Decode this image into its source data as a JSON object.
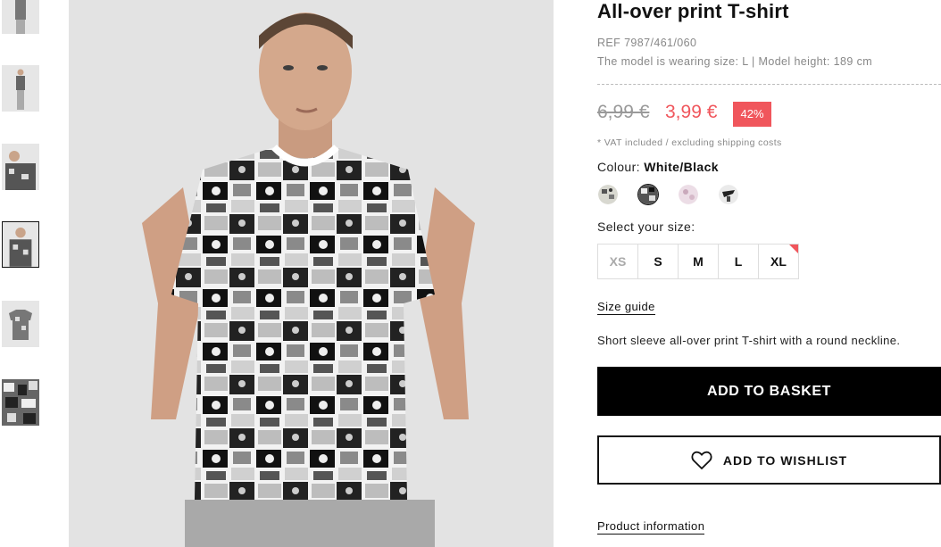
{
  "product": {
    "title": "All-over print T-shirt",
    "ref": "REF 7987/461/060",
    "model_info": "The model is wearing size: L | Model height: 189 cm",
    "price_old": "6,99 €",
    "price_new": "3,99 €",
    "discount": "42%",
    "vat_note": "* VAT included / excluding shipping costs",
    "colour_label": "Colour:",
    "colour_value": "White/Black",
    "size_label": "Select your size:",
    "sizes": [
      "XS",
      "S",
      "M",
      "L",
      "XL"
    ],
    "size_guide": "Size guide",
    "description": "Short sleeve all-over print T-shirt with a round neckline.",
    "add_to_basket": "ADD TO BASKET",
    "add_to_wishlist": "ADD TO WISHLIST",
    "product_information": "Product information"
  },
  "gallery": {
    "thumbnail_count": 6,
    "active_index": 3
  },
  "colors": {
    "accent_red": "#f0565c",
    "button_black": "#000000",
    "text_grey": "#888888"
  },
  "icons": {
    "wishlist": "heart-outline-icon"
  }
}
